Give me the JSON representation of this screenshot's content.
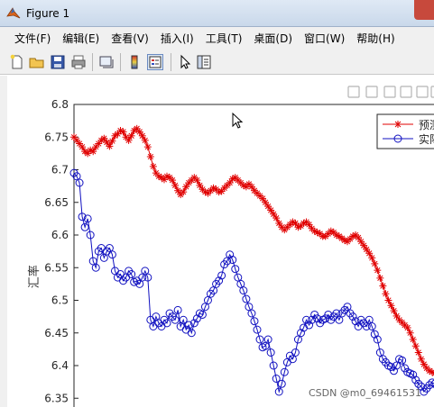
{
  "window": {
    "title": "Figure 1"
  },
  "menu": [
    {
      "label": "文件(F)",
      "name": "menu-file"
    },
    {
      "label": "编辑(E)",
      "name": "menu-edit"
    },
    {
      "label": "查看(V)",
      "name": "menu-view"
    },
    {
      "label": "插入(I)",
      "name": "menu-insert"
    },
    {
      "label": "工具(T)",
      "name": "menu-tools"
    },
    {
      "label": "桌面(D)",
      "name": "menu-desktop"
    },
    {
      "label": "窗口(W)",
      "name": "menu-window"
    },
    {
      "label": "帮助(H)",
      "name": "menu-help"
    }
  ],
  "toolbar_icons": [
    "new-figure-icon",
    "open-icon",
    "save-icon",
    "print-icon",
    "link-icon",
    "colorbar-icon",
    "legend-icon",
    "pointer-icon",
    "property-editor-icon"
  ],
  "axes_toolbar_icons": [
    "export-icon",
    "brush-icon",
    "datatip-icon",
    "pan-icon",
    "zoom-in-icon",
    "zoom-out-icon",
    "home-icon"
  ],
  "watermark": "CSDN @m0_69461531",
  "colors": {
    "predicted": "#e00000",
    "actual": "#1010c0"
  },
  "chart_data": {
    "type": "line",
    "ylabel": "汇率",
    "ylim": [
      6.32,
      6.8
    ],
    "yticks": [
      "6.8",
      "6.75",
      "6.7",
      "6.65",
      "6.6",
      "6.55",
      "6.5",
      "6.45",
      "6.4",
      "6.35"
    ],
    "ytick_values": [
      6.8,
      6.75,
      6.7,
      6.65,
      6.6,
      6.55,
      6.5,
      6.45,
      6.4,
      6.35
    ],
    "legend_position": "top-right",
    "series": [
      {
        "name": "预测",
        "marker": "asterisk",
        "color": "#e00000",
        "values": [
          6.75,
          6.745,
          6.74,
          6.735,
          6.728,
          6.725,
          6.73,
          6.728,
          6.735,
          6.74,
          6.745,
          6.748,
          6.742,
          6.736,
          6.744,
          6.752,
          6.755,
          6.76,
          6.758,
          6.75,
          6.745,
          6.752,
          6.76,
          6.763,
          6.758,
          6.752,
          6.745,
          6.735,
          6.72,
          6.705,
          6.695,
          6.69,
          6.688,
          6.685,
          6.69,
          6.688,
          6.684,
          6.676,
          6.668,
          6.662,
          6.666,
          6.674,
          6.68,
          6.684,
          6.688,
          6.684,
          6.676,
          6.67,
          6.666,
          6.664,
          6.668,
          6.672,
          6.67,
          6.666,
          6.667,
          6.672,
          6.676,
          6.68,
          6.686,
          6.688,
          6.684,
          6.68,
          6.676,
          6.674,
          6.678,
          6.674,
          6.668,
          6.664,
          6.66,
          6.656,
          6.65,
          6.644,
          6.638,
          6.632,
          6.626,
          6.618,
          6.612,
          6.608,
          6.612,
          6.616,
          6.62,
          6.618,
          6.612,
          6.614,
          6.618,
          6.62,
          6.616,
          6.61,
          6.606,
          6.604,
          6.602,
          6.598,
          6.598,
          6.602,
          6.606,
          6.604,
          6.6,
          6.598,
          6.595,
          6.592,
          6.59,
          6.594,
          6.598,
          6.6,
          6.596,
          6.59,
          6.584,
          6.578,
          6.572,
          6.565,
          6.556,
          6.546,
          6.534,
          6.522,
          6.51,
          6.5,
          6.492,
          6.484,
          6.476,
          6.47,
          6.466,
          6.462,
          6.458,
          6.45,
          6.44,
          6.43,
          6.42,
          6.41,
          6.402,
          6.396,
          6.392,
          6.39,
          6.388,
          6.392,
          6.398
        ]
      },
      {
        "name": "实际",
        "marker": "circle",
        "color": "#1010c0",
        "values": [
          6.695,
          6.69,
          6.68,
          6.628,
          6.612,
          6.625,
          6.6,
          6.56,
          6.55,
          6.575,
          6.58,
          6.565,
          6.575,
          6.58,
          6.57,
          6.545,
          6.535,
          6.54,
          6.53,
          6.535,
          6.545,
          6.54,
          6.528,
          6.53,
          6.525,
          6.535,
          6.545,
          6.535,
          6.47,
          6.46,
          6.475,
          6.465,
          6.46,
          6.47,
          6.465,
          6.48,
          6.475,
          6.47,
          6.485,
          6.46,
          6.47,
          6.455,
          6.462,
          6.45,
          6.465,
          6.472,
          6.48,
          6.478,
          6.49,
          6.5,
          6.51,
          6.515,
          6.525,
          6.53,
          6.538,
          6.555,
          6.56,
          6.57,
          6.562,
          6.548,
          6.535,
          6.525,
          6.515,
          6.502,
          6.49,
          6.48,
          6.468,
          6.455,
          6.44,
          6.428,
          6.43,
          6.44,
          6.42,
          6.4,
          6.38,
          6.36,
          6.372,
          6.39,
          6.405,
          6.415,
          6.41,
          6.42,
          6.44,
          6.45,
          6.458,
          6.47,
          6.462,
          6.47,
          6.478,
          6.472,
          6.465,
          6.47,
          6.472,
          6.478,
          6.47,
          6.475,
          6.48,
          6.47,
          6.48,
          6.485,
          6.49,
          6.48,
          6.475,
          6.468,
          6.46,
          6.47,
          6.465,
          6.46,
          6.47,
          6.46,
          6.448,
          6.44,
          6.42,
          6.41,
          6.405,
          6.4,
          6.398,
          6.392,
          6.4,
          6.41,
          6.408,
          6.396,
          6.39,
          6.388,
          6.386,
          6.378,
          6.372,
          6.368,
          6.36,
          6.365,
          6.37,
          6.374,
          6.372,
          6.368,
          6.366
        ]
      }
    ]
  }
}
